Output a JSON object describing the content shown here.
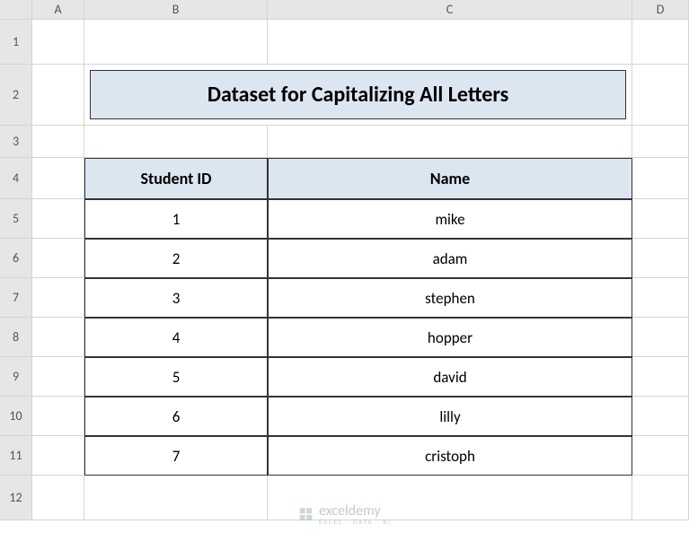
{
  "columns": [
    "A",
    "B",
    "C",
    "D"
  ],
  "rows": [
    "1",
    "2",
    "3",
    "4",
    "5",
    "6",
    "7",
    "8",
    "9",
    "10",
    "11",
    "12"
  ],
  "title": "Dataset for Capitalizing All Letters",
  "headers": {
    "studentId": "Student ID",
    "name": "Name"
  },
  "data": [
    {
      "id": "1",
      "name": "mike"
    },
    {
      "id": "2",
      "name": "adam"
    },
    {
      "id": "3",
      "name": "stephen"
    },
    {
      "id": "4",
      "name": "hopper"
    },
    {
      "id": "5",
      "name": "david"
    },
    {
      "id": "6",
      "name": "lilly"
    },
    {
      "id": "7",
      "name": "cristoph"
    }
  ],
  "watermark": {
    "brand": "exceldemy",
    "tagline": "EXCEL · DATA · BI"
  },
  "chart_data": {
    "type": "table",
    "title": "Dataset for Capitalizing All Letters",
    "columns": [
      "Student ID",
      "Name"
    ],
    "rows": [
      [
        "1",
        "mike"
      ],
      [
        "2",
        "adam"
      ],
      [
        "3",
        "stephen"
      ],
      [
        "4",
        "hopper"
      ],
      [
        "5",
        "david"
      ],
      [
        "6",
        "lilly"
      ],
      [
        "7",
        "cristoph"
      ]
    ]
  }
}
